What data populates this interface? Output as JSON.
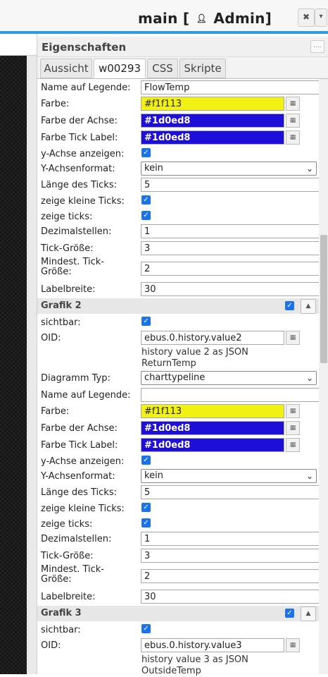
{
  "window": {
    "title_pre": "main [",
    "title_icon": "person-icon",
    "title_user": "Admin]",
    "close_glyph": "✖",
    "menu_glyph": "▾"
  },
  "panel": {
    "title": "Eigenschaften",
    "grip": "....",
    "tabs": [
      "Aussicht",
      "w00293",
      "CSS",
      "Skripte"
    ]
  },
  "picker_glyph": "▦",
  "check_glyph": "✓",
  "collapse_glyph": "▲",
  "select_glyph": "⌄",
  "section1": {
    "legend_label": "Name auf Legende:",
    "legend_value": "FlowTemp",
    "color_label": "Farbe:",
    "color_value": "#f1f113",
    "axis_color_label": "Farbe der Achse:",
    "axis_color_value": "#1d0ed8",
    "tick_label_color_label": "Farbe Tick Label:",
    "tick_label_color_value": "#1d0ed8",
    "show_y_label": "y-Achse anzeigen:",
    "y_format_label": "Y-Achsenformat:",
    "y_format_value": "kein",
    "tick_length_label": "Länge des Ticks:",
    "tick_length_value": "5",
    "small_ticks_label": "zeige kleine Ticks:",
    "show_ticks_label": "zeige ticks:",
    "decimals_label": "Dezimalstellen:",
    "decimals_value": "1",
    "tick_size_label": "Tick-Größe:",
    "tick_size_value": "3",
    "min_tick_size_label": "Mindest. Tick-Größe:",
    "min_tick_size_value": "2",
    "label_width_label": "Labelbreite:",
    "label_width_value": "30"
  },
  "group2": {
    "title": "Grafik 2",
    "visible_label": "sichtbar:",
    "oid_label": "OID:",
    "oid_value": "ebus.0.history.value2",
    "oid_note_1": "history value 2 as JSON",
    "oid_note_2": "ReturnTemp",
    "type_label": "Diagramm Typ:",
    "type_value": "charttypeline",
    "legend_label": "Name auf Legende:",
    "legend_value": "",
    "color_label": "Farbe:",
    "color_value": "#f1f113",
    "axis_color_label": "Farbe der Achse:",
    "axis_color_value": "#1d0ed8",
    "tick_label_color_label": "Farbe Tick Label:",
    "tick_label_color_value": "#1d0ed8",
    "show_y_label": "y-Achse anzeigen:",
    "y_format_label": "Y-Achsenformat:",
    "y_format_value": "kein",
    "tick_length_label": "Länge des Ticks:",
    "tick_length_value": "5",
    "small_ticks_label": "zeige kleine Ticks:",
    "show_ticks_label": "zeige ticks:",
    "decimals_label": "Dezimalstellen:",
    "decimals_value": "1",
    "tick_size_label": "Tick-Größe:",
    "tick_size_value": "3",
    "min_tick_size_label": "Mindest. Tick-Größe:",
    "min_tick_size_value": "2",
    "label_width_label": "Labelbreite:",
    "label_width_value": "30"
  },
  "group3": {
    "title": "Grafik 3",
    "visible_label": "sichtbar:",
    "oid_label": "OID:",
    "oid_value": "ebus.0.history.value3",
    "oid_note_1": "history value 3 as JSON",
    "oid_note_2": "OutsideTemp"
  },
  "colors": {
    "accent": "#2f9be0",
    "yellow": "#f1f113",
    "blue": "#1d0ed8",
    "checkbox": "#1a73e8"
  }
}
